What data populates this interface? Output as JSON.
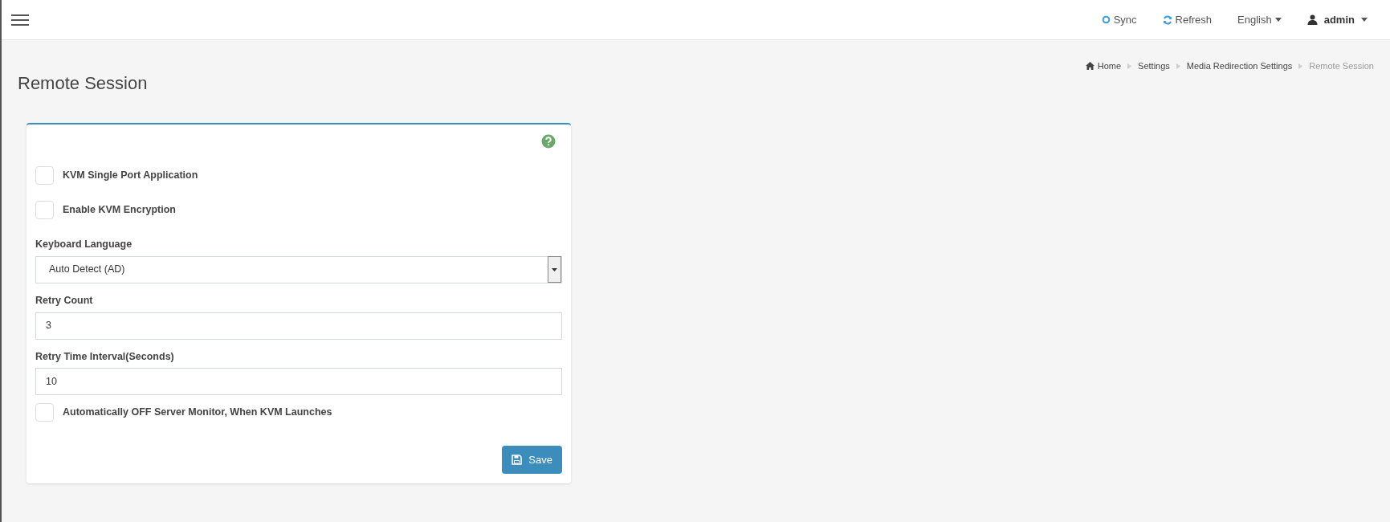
{
  "header": {
    "actions": [
      {
        "kind": "sync",
        "label": "Sync"
      },
      {
        "kind": "refresh",
        "label": "Refresh"
      },
      {
        "kind": "language",
        "label": "English"
      },
      {
        "kind": "user",
        "label": "admin"
      }
    ]
  },
  "breadcrumb": [
    {
      "label": "Home",
      "current": false
    },
    {
      "label": "Settings",
      "current": false
    },
    {
      "label": "Media Redirection Settings",
      "current": false
    },
    {
      "label": "Remote Session",
      "current": true
    }
  ],
  "page_title": "Remote Session",
  "form": {
    "fields": [
      {
        "kind": "checkbox",
        "label": "KVM Single Port Application",
        "checked": false
      },
      {
        "kind": "checkbox",
        "label": "Enable KVM Encryption",
        "checked": false
      },
      {
        "kind": "select",
        "label": "Keyboard Language",
        "value": "Auto Detect (AD)"
      },
      {
        "kind": "text",
        "label": "Retry Count",
        "value": "3"
      },
      {
        "kind": "text",
        "label": "Retry Time Interval(Seconds)",
        "value": "10"
      },
      {
        "kind": "checkbox",
        "label": "Automatically OFF Server Monitor, When KVM Launches",
        "checked": false
      }
    ],
    "save_button": "Save"
  }
}
